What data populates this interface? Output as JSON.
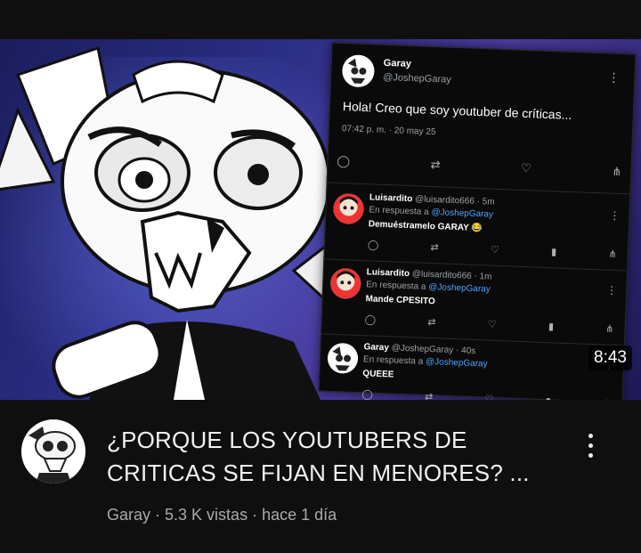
{
  "video": {
    "title_line1": "¿PORQUE LOS YOUTUBERS DE",
    "title_line2": "CRITICAS SE FIJAN EN MENORES? ...",
    "channel": "Garay",
    "separator1": " · ",
    "views": "5.3 K vistas",
    "separator2": " · ",
    "age": "hace 1 día",
    "duration": "8:43"
  },
  "thumbnail": {
    "tweet": {
      "name": "Garay",
      "handle": "@JoshepGaray",
      "text": "Hola! Creo que soy youtuber de críticas...",
      "time": "07:42 p. m. · 20 may 25"
    },
    "replies": [
      {
        "name": "Luisardito",
        "handle": "@luisardito666 · 5m",
        "reply_prefix": "En respuesta a ",
        "reply_to": "@JoshepGaray",
        "text": "Demuéstramelo GARAY 😂"
      },
      {
        "name": "Luisardito",
        "handle": "@luisardito666 · 1m",
        "reply_prefix": "En respuesta a ",
        "reply_to": "@JoshepGaray",
        "text": "Mande CPESITO"
      },
      {
        "name": "Garay",
        "handle": "@JoshepGaray · 40s",
        "reply_prefix": "En respuesta a ",
        "reply_to": "@JoshepGaray",
        "text": "QUEEE"
      }
    ]
  },
  "icons": {
    "reply": "reply-icon",
    "retweet": "retweet-icon",
    "like": "heart-icon",
    "share": "share-icon",
    "stats": "stats-icon",
    "more": "more-vertical-icon"
  },
  "colors": {
    "background": "#0f0f0f",
    "title": "#f1f1f1",
    "subtitle": "#aaaaaa",
    "link": "#4da3ff"
  }
}
